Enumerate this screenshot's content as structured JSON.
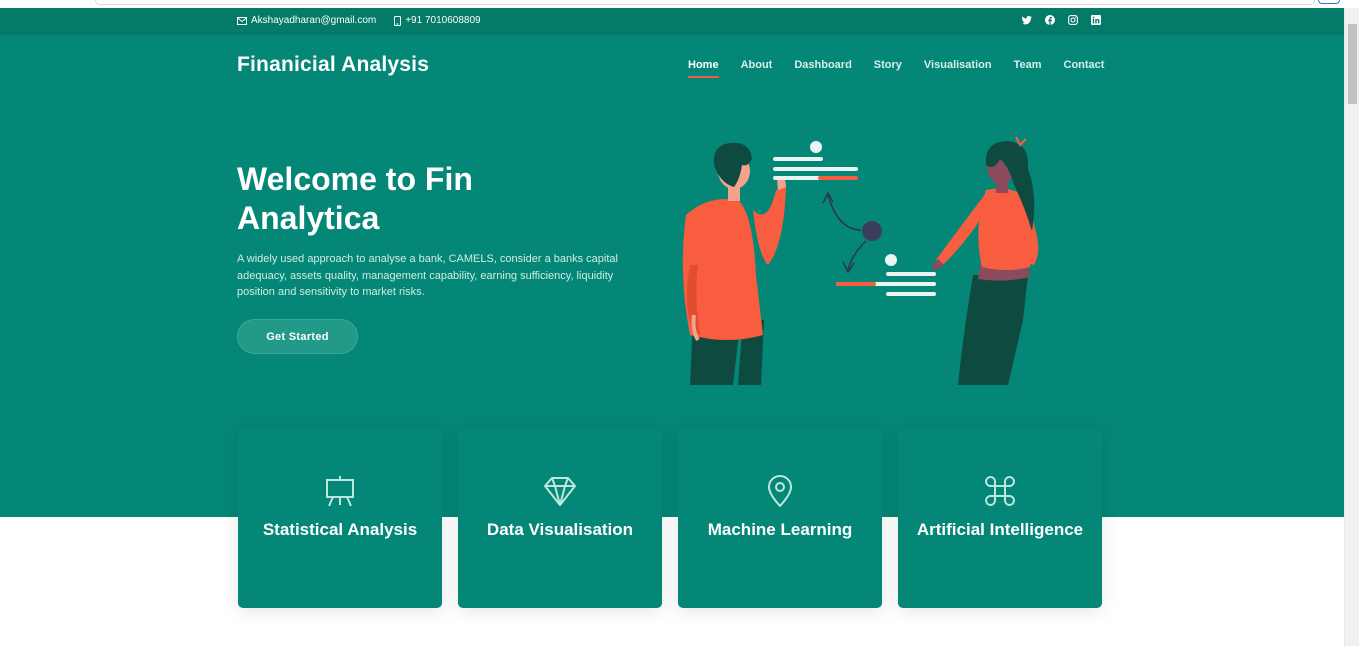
{
  "topbar": {
    "email": "Akshayadharan@gmail.com",
    "phone": "+91 7010608809",
    "social_icons": [
      "twitter-icon",
      "facebook-icon",
      "instagram-icon",
      "linkedin-icon"
    ]
  },
  "header": {
    "brand": "Finanicial Analysis",
    "nav": [
      {
        "label": "Home",
        "active": true
      },
      {
        "label": "About"
      },
      {
        "label": "Dashboard"
      },
      {
        "label": "Story"
      },
      {
        "label": "Visualisation"
      },
      {
        "label": "Team"
      },
      {
        "label": "Contact"
      }
    ]
  },
  "hero": {
    "title": "Welcome to Fin Analytica",
    "description": "A widely used approach to analyse a bank, CAMELS, consider a banks capital adequacy, assets quality, management capability, earning sufficiency, liquidity position and sensitivity to market risks.",
    "cta_label": "Get Started"
  },
  "cards": [
    {
      "title": "Statistical Analysis",
      "icon": "easel-icon"
    },
    {
      "title": "Data Visualisation",
      "icon": "gem-icon"
    },
    {
      "title": "Machine Learning",
      "icon": "map-pin-icon"
    },
    {
      "title": "Artificial Intelligence",
      "icon": "command-icon"
    }
  ],
  "colors": {
    "primary": "#048777",
    "topbar": "#047a68",
    "accent": "#ef5b43"
  }
}
